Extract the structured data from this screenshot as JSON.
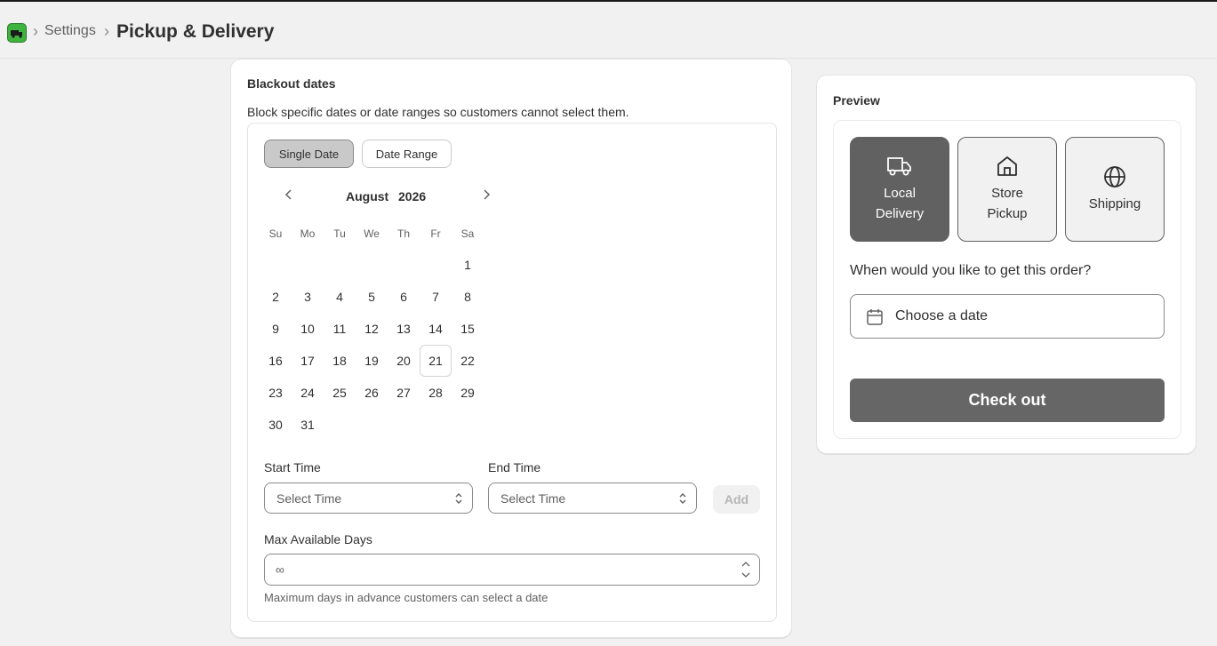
{
  "breadcrumb": {
    "app_icon": "truck-app-icon",
    "separator": "›",
    "settings": "Settings",
    "current": "Pickup & Delivery"
  },
  "blackout": {
    "title": "Blackout dates",
    "description": "Block specific dates or date ranges so customers cannot select them.",
    "modes": [
      "Single Date",
      "Date Range"
    ],
    "selected_mode": "Single Date",
    "calendar": {
      "month": "August",
      "year": "2026",
      "weekdays": [
        "Su",
        "Mo",
        "Tu",
        "We",
        "Th",
        "Fr",
        "Sa"
      ],
      "highlighted_day": "21",
      "weeks": [
        [
          "",
          "",
          "",
          "",
          "",
          "",
          "1"
        ],
        [
          "2",
          "3",
          "4",
          "5",
          "6",
          "7",
          "8"
        ],
        [
          "9",
          "10",
          "11",
          "12",
          "13",
          "14",
          "15"
        ],
        [
          "16",
          "17",
          "18",
          "19",
          "20",
          "21",
          "22"
        ],
        [
          "23",
          "24",
          "25",
          "26",
          "27",
          "28",
          "29"
        ],
        [
          "30",
          "31",
          "",
          "",
          "",
          "",
          ""
        ]
      ]
    },
    "start_time": {
      "label": "Start Time",
      "placeholder": "Select Time"
    },
    "end_time": {
      "label": "End Time",
      "placeholder": "Select Time"
    },
    "add_label": "Add",
    "max_days": {
      "label": "Max Available Days",
      "value": "∞",
      "help": "Maximum days in advance customers can select a date"
    }
  },
  "preview": {
    "title": "Preview",
    "methods": [
      {
        "line1": "Local",
        "line2": "Delivery",
        "icon": "truck-icon",
        "active": true
      },
      {
        "line1": "Store",
        "line2": "Pickup",
        "icon": "home-icon",
        "active": false
      },
      {
        "line1": "Shipping",
        "line2": "",
        "icon": "globe-icon",
        "active": false
      }
    ],
    "question": "When would you like to get this order?",
    "date_placeholder": "Choose a date",
    "checkout_label": "Check out"
  },
  "colors": {
    "active_method_bg": "#616161",
    "checkout_bg": "#666666",
    "selected_segment_bg": "#c9c9c9"
  }
}
